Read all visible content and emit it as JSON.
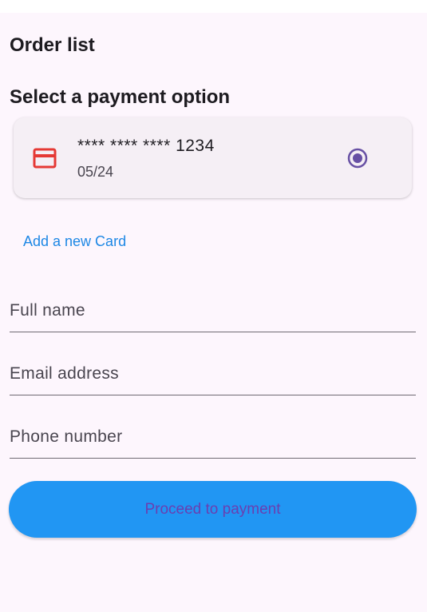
{
  "header": {
    "title": "Order list"
  },
  "payment": {
    "section_title": "Select a payment option",
    "card": {
      "icon": "credit-card-icon",
      "number": "**** **** **** 1234",
      "expiry": "05/24",
      "selected": true
    },
    "add_card_label": "Add a new Card"
  },
  "form": {
    "full_name": {
      "placeholder": "Full name",
      "value": ""
    },
    "email": {
      "placeholder": "Email address",
      "value": ""
    },
    "phone": {
      "placeholder": "Phone number",
      "value": ""
    }
  },
  "actions": {
    "proceed_label": "Proceed to payment"
  },
  "colors": {
    "background": "#fdf6fd",
    "card_background": "#f5eff5",
    "card_icon": "#e53935",
    "radio": "#6750a4",
    "link": "#1e88e5",
    "button": "#2196f3",
    "button_text": "#6a3fb0"
  }
}
